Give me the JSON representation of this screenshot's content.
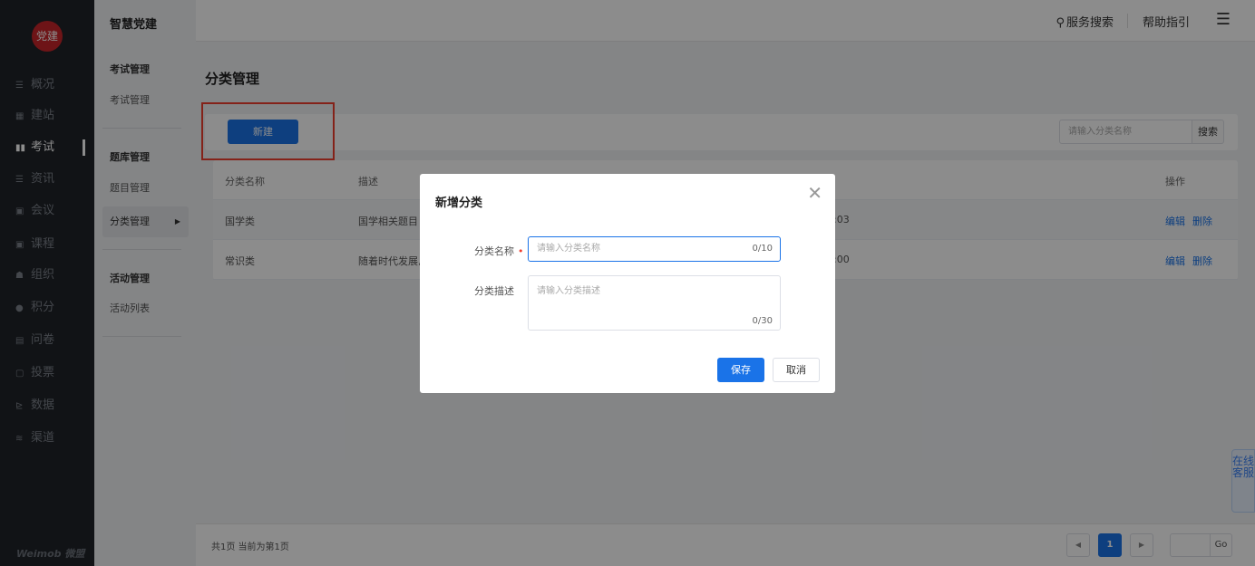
{
  "logo": {
    "text": "党建",
    "color": "#c8252a"
  },
  "leftnav": {
    "items": [
      {
        "icon": "☰",
        "label": "概况",
        "active": false
      },
      {
        "icon": "▦",
        "label": "建站",
        "active": false
      },
      {
        "icon": "▮▮",
        "label": "考试",
        "active": true
      },
      {
        "icon": "☰",
        "label": "资讯",
        "active": false
      },
      {
        "icon": "▣",
        "label": "会议",
        "active": false
      },
      {
        "icon": "▣",
        "label": "课程",
        "active": false
      },
      {
        "icon": "☗",
        "label": "组织",
        "active": false
      },
      {
        "icon": "●",
        "label": "积分",
        "active": false
      },
      {
        "icon": "▤",
        "label": "问卷",
        "active": false
      },
      {
        "icon": "▢",
        "label": "投票",
        "active": false
      },
      {
        "icon": "⊵",
        "label": "数据",
        "active": false
      },
      {
        "icon": "≋",
        "label": "渠道",
        "active": false
      }
    ],
    "brand": "Weimob 微盟"
  },
  "subnav": {
    "app_name": "智慧党建",
    "groups": [
      {
        "title": "考试管理",
        "items": [
          "考试管理"
        ]
      },
      {
        "title": "题库管理",
        "items": [
          "题目管理",
          "分类管理"
        ]
      },
      {
        "title": "活动管理",
        "items": [
          "活动列表"
        ]
      }
    ],
    "active_item": "分类管理"
  },
  "topbar": {
    "search_label": "服务搜索",
    "help_label": "帮助指引"
  },
  "main": {
    "page_title": "分类管理",
    "new_button": "新建",
    "search_placeholder": "请输入分类名称",
    "search_button": "搜索",
    "table": {
      "headers": [
        "分类名称",
        "描述",
        "",
        "操作"
      ],
      "rows": [
        {
          "name": "国学类",
          "desc": "国学相关题目",
          "time": ":03",
          "actions": [
            "编辑",
            "删除"
          ]
        },
        {
          "name": "常识类",
          "desc": "随着时代发展,",
          "time": ":00",
          "actions": [
            "编辑",
            "删除"
          ]
        }
      ]
    },
    "pagination": {
      "info": "共1页 当前为第1页",
      "current_page": "1",
      "go_label": "Go"
    },
    "service_tab": "在线客服"
  },
  "modal": {
    "title": "新增分类",
    "fields": [
      {
        "label": "分类名称",
        "placeholder": "请输入分类名称",
        "count": "0/10",
        "required": true
      },
      {
        "label": "分类描述",
        "placeholder": "请输入分类描述",
        "count": "0/30",
        "required": false
      }
    ],
    "save_button": "保存",
    "cancel_button": "取消"
  },
  "colors": {
    "primary": "#1a73e8",
    "highlight_box": "#f03e2f",
    "nav_bg": "#1f2329"
  }
}
